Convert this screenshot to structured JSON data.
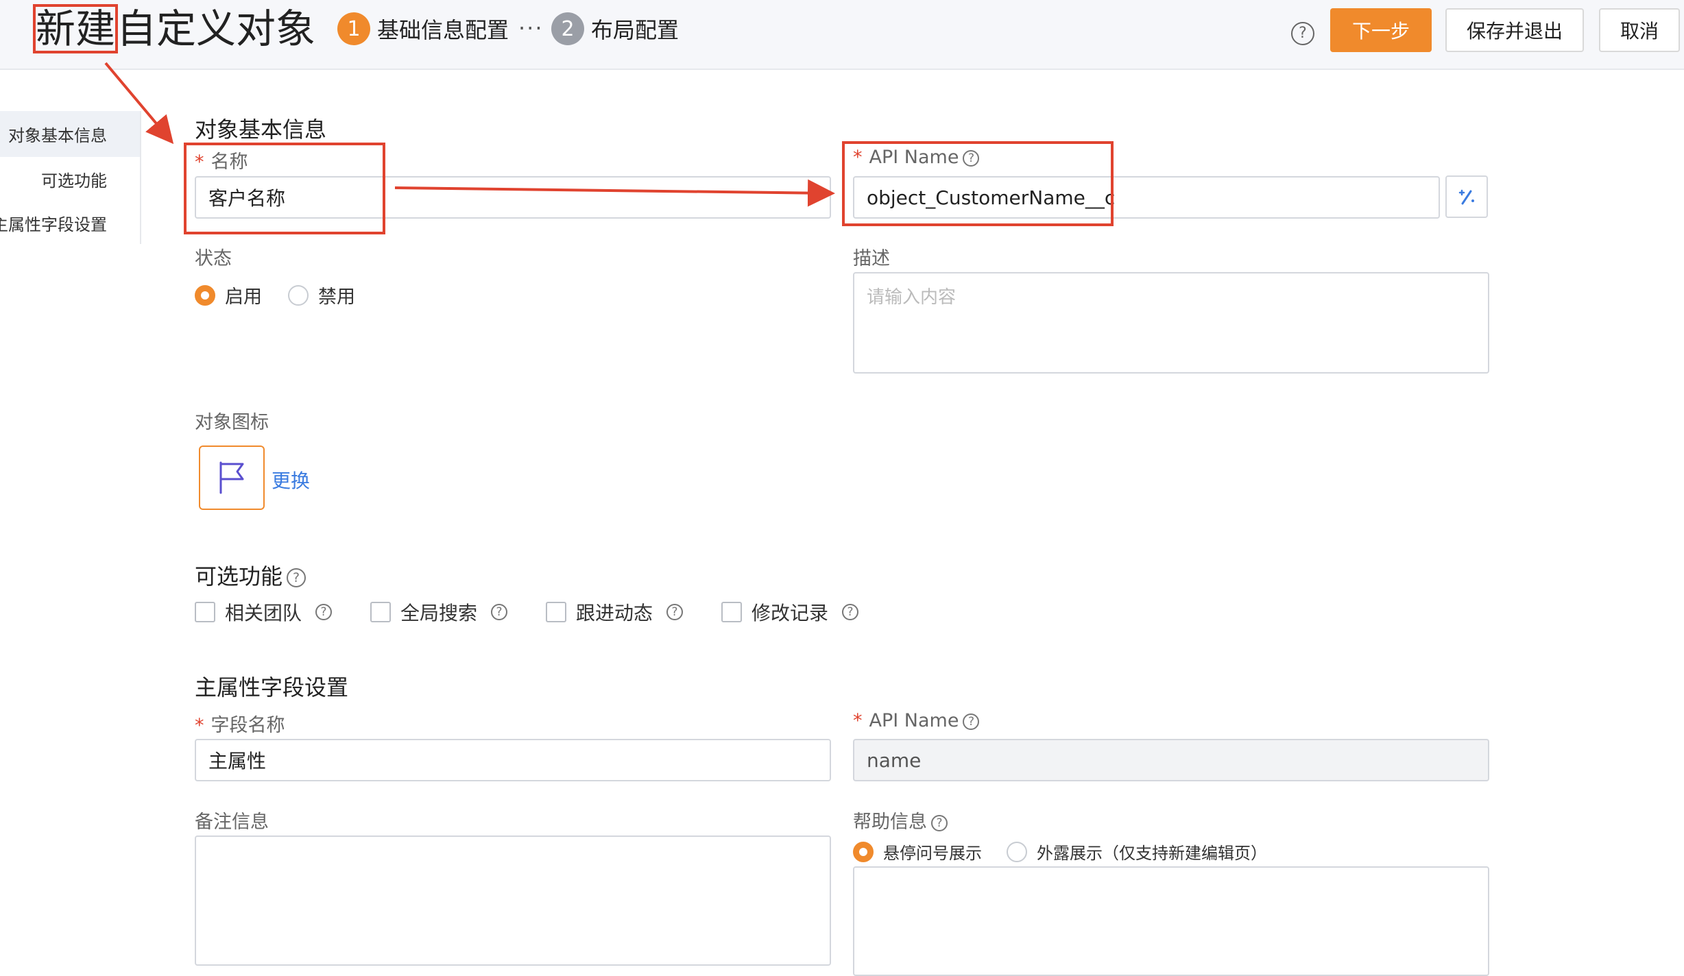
{
  "header": {
    "title_highlight": "新建",
    "title_rest": "自定义对象",
    "steps": [
      {
        "number": "1",
        "label": "基础信息配置",
        "color": "#f08a2c"
      },
      {
        "number": "2",
        "label": "布局配置",
        "color": "#9a9ea6"
      }
    ],
    "steps_separator": "···",
    "help_icon": "?",
    "next_button": "下一步",
    "save_exit_button": "保存并退出",
    "cancel_button": "取消"
  },
  "sidenav": {
    "items": [
      {
        "label": "对象基本信息"
      },
      {
        "label": "可选功能"
      },
      {
        "label": "主属性字段设置"
      }
    ]
  },
  "basic_info": {
    "section_title": "对象基本信息",
    "required_mark": "*",
    "name_label": "名称",
    "name_value": "客户名称",
    "api_name_label": "API Name",
    "api_name_value": "object_CustomerName__c",
    "status_label": "状态",
    "status_options": [
      "启用",
      "禁用"
    ],
    "description_label": "描述",
    "description_placeholder": "请输入内容",
    "icon_label": "对象图标",
    "icon_change_link": "更换"
  },
  "optional_features": {
    "section_title": "可选功能",
    "items": [
      "相关团队",
      "全局搜索",
      "跟进动态",
      "修改记录"
    ]
  },
  "primary_field": {
    "section_title": "主属性字段设置",
    "field_name_label": "字段名称",
    "field_name_value": "主属性",
    "api_name_label": "API Name",
    "api_name_value": "name",
    "remark_label": "备注信息",
    "help_label": "帮助信息",
    "help_options": [
      "悬停问号展示",
      "外露展示（仅支持新建编辑页）"
    ]
  },
  "colors": {
    "accent": "#f08a2c",
    "annotation_red": "#e0432f",
    "link_blue": "#3a7be0"
  }
}
